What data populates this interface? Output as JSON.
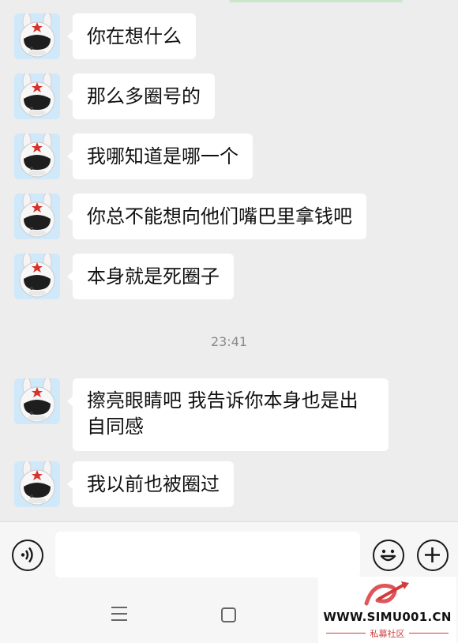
{
  "chat": {
    "messages": [
      {
        "text": "你在想什么"
      },
      {
        "text": "那么多圈号的"
      },
      {
        "text": "我哪知道是哪一个"
      },
      {
        "text": "你总不能想向他们嘴巴里拿钱吧"
      },
      {
        "text": "本身就是死圈子"
      },
      {
        "text": "擦亮眼睛吧 我告诉你本身也是出自同感"
      },
      {
        "text": "我以前也被圈过"
      }
    ],
    "timestamp": "23:41"
  },
  "input_bar": {
    "voice_icon": "voice-icon",
    "emoji_icon": "emoji-icon",
    "plus_icon": "plus-icon",
    "input_value": ""
  },
  "nav": {
    "menu_icon": "menu-icon",
    "home_icon": "home-square-icon"
  },
  "watermark": {
    "url": "WWW.SIMU001.CN",
    "subtitle": "私募社区"
  },
  "colors": {
    "background": "#ededed",
    "bubble": "#ffffff",
    "watermark_red": "#d23c3c"
  }
}
